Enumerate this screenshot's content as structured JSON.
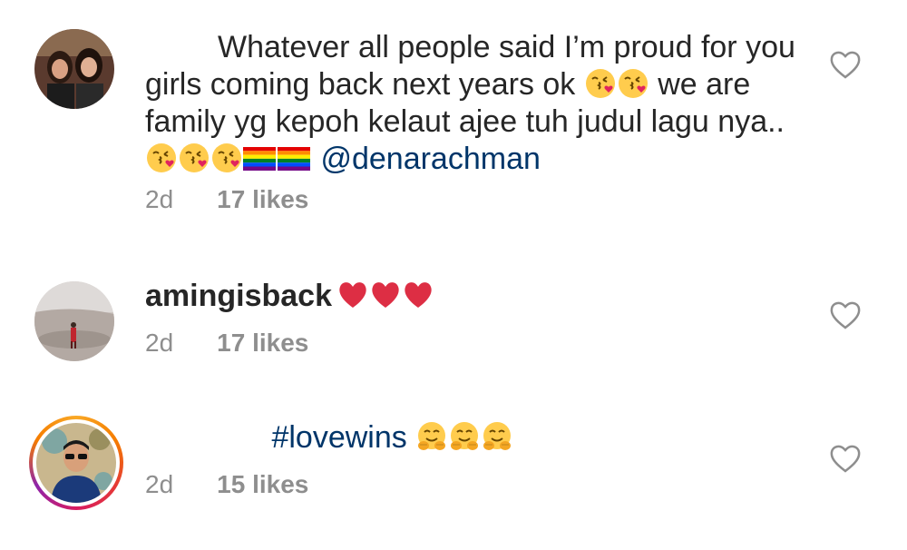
{
  "comments": [
    {
      "username": "",
      "text_line1": "Whatever all people said I’m proud for you",
      "text_line2a": "girls coming back next years ok",
      "text_line2b": "we are",
      "text_line3": "family yg kepoh kelaut ajee tuh judul lagu nya..",
      "mention": "@denarachman",
      "time": "2d",
      "likes": "17 likes",
      "emoji_kiss": "kissing-face-icon",
      "emoji_flag": "rainbow-flag-icon"
    },
    {
      "username": "amingisback",
      "text": "",
      "time": "2d",
      "likes": "17 likes",
      "emoji": "red-heart-icon"
    },
    {
      "username": "",
      "hashtag": "#lovewins",
      "time": "2d",
      "likes": "15 likes",
      "emoji": "hugging-face-icon"
    }
  ],
  "colors": {
    "text": "#262626",
    "meta": "#8e8e8e",
    "link": "#003569",
    "heart_outline": "#8e8e8e"
  }
}
